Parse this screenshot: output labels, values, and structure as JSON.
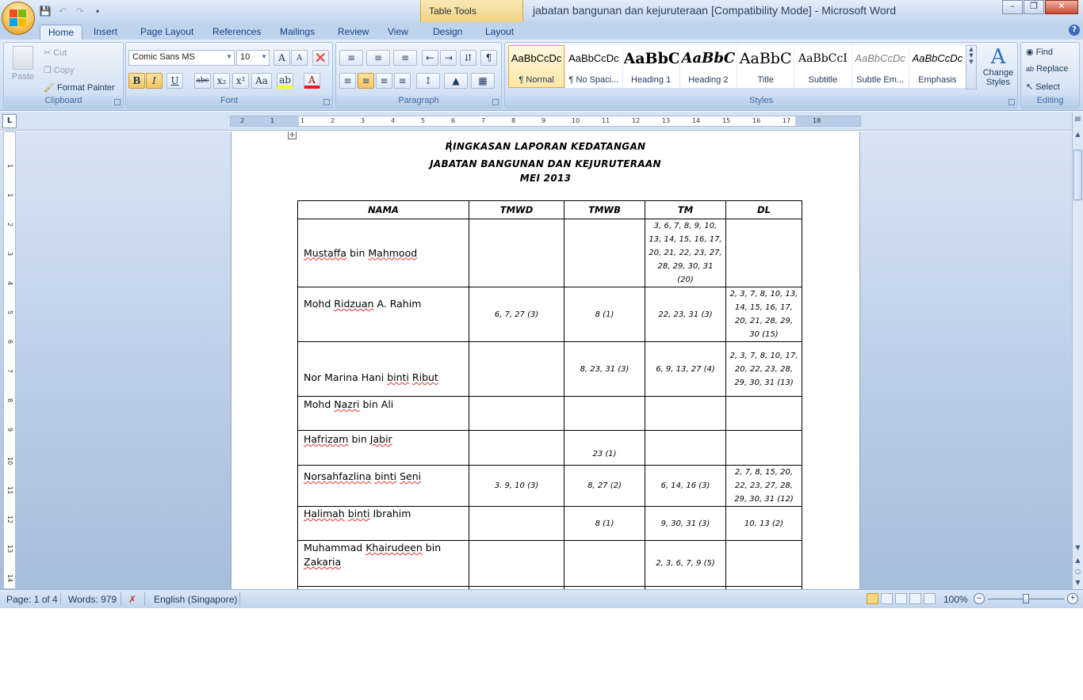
{
  "window": {
    "title": "jabatan bangunan dan kejuruteraan [Compatibility Mode] - Microsoft Word",
    "contextual_tab_group": "Table Tools",
    "controls": [
      "minimize",
      "maximize",
      "close"
    ]
  },
  "tabs": [
    "Home",
    "Insert",
    "Page Layout",
    "References",
    "Mailings",
    "Review",
    "View",
    "Design",
    "Layout"
  ],
  "active_tab": "Home",
  "ribbon": {
    "clipboard": {
      "label": "Clipboard",
      "paste": "Paste",
      "cut": "Cut",
      "copy": "Copy",
      "format_painter": "Format Painter"
    },
    "font": {
      "label": "Font",
      "font_name": "Comic Sans MS",
      "font_size": "10",
      "grow": "A",
      "shrink": "A",
      "bold": "B",
      "italic": "I",
      "underline": "U",
      "strike": "abc",
      "subscript": "x₂",
      "superscript": "x²",
      "change_case": "Aa"
    },
    "paragraph": {
      "label": "Paragraph"
    },
    "styles": {
      "label": "Styles",
      "items": [
        {
          "preview": "AaBbCcDc",
          "name": "¶ Normal"
        },
        {
          "preview": "AaBbCcDc",
          "name": "¶ No Spaci..."
        },
        {
          "preview": "AaBbC",
          "name": "Heading 1"
        },
        {
          "preview": "AaBbC",
          "name": "Heading 2"
        },
        {
          "preview": "AaBbC",
          "name": "Title"
        },
        {
          "preview": "AaBbCcI",
          "name": "Subtitle"
        },
        {
          "preview": "AaBbCcDc",
          "name": "Subtle Em..."
        },
        {
          "preview": "AaBbCcDc",
          "name": "Emphasis"
        }
      ],
      "change_styles": "Change Styles"
    },
    "editing": {
      "label": "Editing",
      "find": "Find",
      "replace": "Replace",
      "select": "Select"
    }
  },
  "ruler": {
    "corner": "L",
    "h_ticks": [
      "2",
      "1",
      "1",
      "2",
      "3",
      "4",
      "5",
      "6",
      "7",
      "8",
      "9",
      "10",
      "11",
      "12",
      "13",
      "14",
      "15",
      "16",
      "17",
      "18"
    ],
    "v_ticks": [
      "1",
      "1",
      "2",
      "3",
      "4",
      "5",
      "6",
      "7",
      "8",
      "9",
      "10",
      "11",
      "12",
      "13",
      "14",
      "15"
    ]
  },
  "document": {
    "heading1": "RINGKASAN LAPORAN KEDATANGAN",
    "heading2": "JABATAN BANGUNAN DAN KEJURUTERAAN",
    "heading3": "MEI   2013",
    "table": {
      "headers": [
        "NAMA",
        "TMWD",
        "TMWB",
        "TM",
        "DL"
      ],
      "rows": [
        {
          "name": "Mustaffa bin Mahmood",
          "tmwd": "",
          "tmwb": "",
          "tm": "3, 6, 7, 8, 9, 10, 13, 14, 15, 16, 17, 20, 21, 22, 23, 27, 28, 29, 30, 31 (20)",
          "dl": ""
        },
        {
          "name": "Mohd Ridzuan A. Rahim",
          "tmwd": "6, 7, 27 (3)",
          "tmwb": "8 (1)",
          "tm": "22, 23, 31 (3)",
          "dl": "2, 3, 7, 8, 10, 13, 14, 15, 16, 17, 20, 21, 28, 29, 30 (15)"
        },
        {
          "name": "Nor Marina Hani binti Ribut",
          "tmwd": "",
          "tmwb": "8, 23, 31 (3)",
          "tm": "6, 9, 13, 27 (4)",
          "dl": "2, 3, 7, 8, 10, 17, 20, 22, 23, 28, 29, 30, 31 (13)"
        },
        {
          "name": "Mohd Nazri bin Ali",
          "tmwd": "",
          "tmwb": "",
          "tm": "",
          "dl": ""
        },
        {
          "name": "Hafrizam bin Jabir",
          "tmwd": "",
          "tmwb": "23 (1)",
          "tm": "",
          "dl": ""
        },
        {
          "name": "Norsahfazlina binti Seni",
          "tmwd": "3. 9, 10 (3)",
          "tmwb": "8, 27 (2)",
          "tm": "6, 14, 16 (3)",
          "dl": "2, 7, 8, 15, 20, 22, 23, 27, 28, 29, 30, 31 (12)"
        },
        {
          "name": "Halimah binti Ibrahim",
          "tmwd": "",
          "tmwb": "8 (1)",
          "tm": "9, 30, 31 (3)",
          "dl": "10, 13 (2)"
        },
        {
          "name": "Muhammad Khairudeen bin Zakaria",
          "tmwd": "",
          "tmwb": "",
          "tm": "2, 3, 6, 7, 9 (5)",
          "dl": ""
        }
      ]
    }
  },
  "statusbar": {
    "page": "Page: 1 of 4",
    "words": "Words: 979",
    "language": "English (Singapore)",
    "zoom": "100%",
    "zoom_level": 1.0
  },
  "colors": {
    "ribbon": "#d0e0f3",
    "accent": "#15428b",
    "doc_background": "#b8cbe6"
  }
}
